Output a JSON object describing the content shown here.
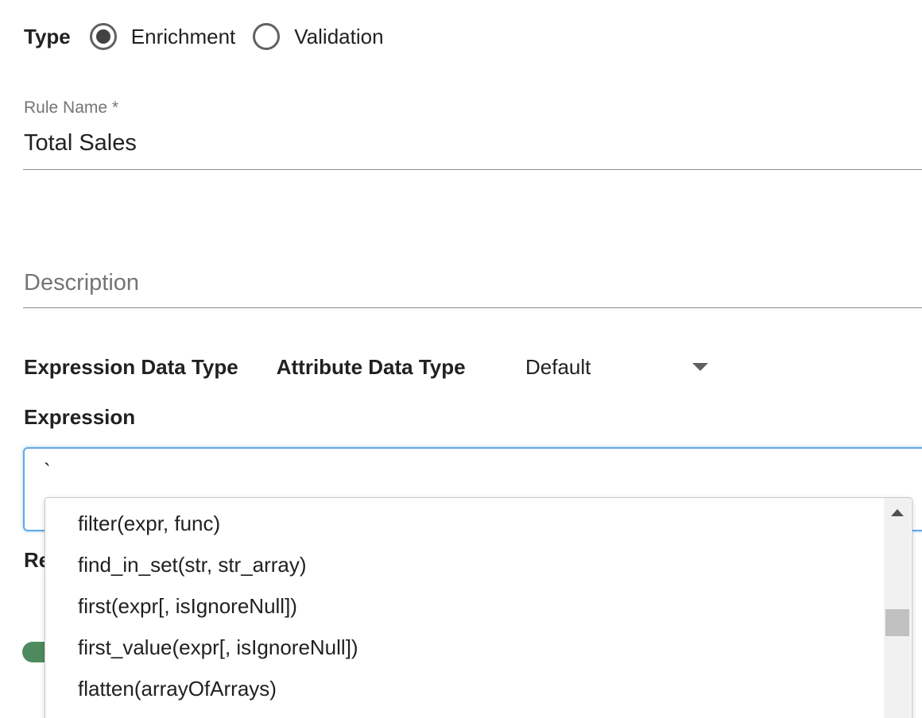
{
  "type_selector": {
    "label": "Type",
    "options": [
      {
        "label": "Enrichment",
        "selected": true
      },
      {
        "label": "Validation",
        "selected": false
      }
    ]
  },
  "rule_name": {
    "label": "Rule Name *",
    "value": "Total Sales"
  },
  "description": {
    "placeholder": "Description"
  },
  "data_types": {
    "expression_label": "Expression Data Type",
    "attribute_label": "Attribute Data Type",
    "attribute_selected": "Default"
  },
  "expression": {
    "label": "Expression",
    "value": "`"
  },
  "partially_hidden": {
    "label_fragment": "Re"
  },
  "autocomplete": {
    "items": [
      "filter(expr, func)",
      "find_in_set(str, str_array)",
      "first(expr[, isIgnoreNull])",
      "first_value(expr[, isIgnoreNull])",
      "flatten(arrayOfArrays)"
    ]
  },
  "colors": {
    "focus_border": "#64a8e8",
    "toggle_on": "#4e8a5e"
  }
}
